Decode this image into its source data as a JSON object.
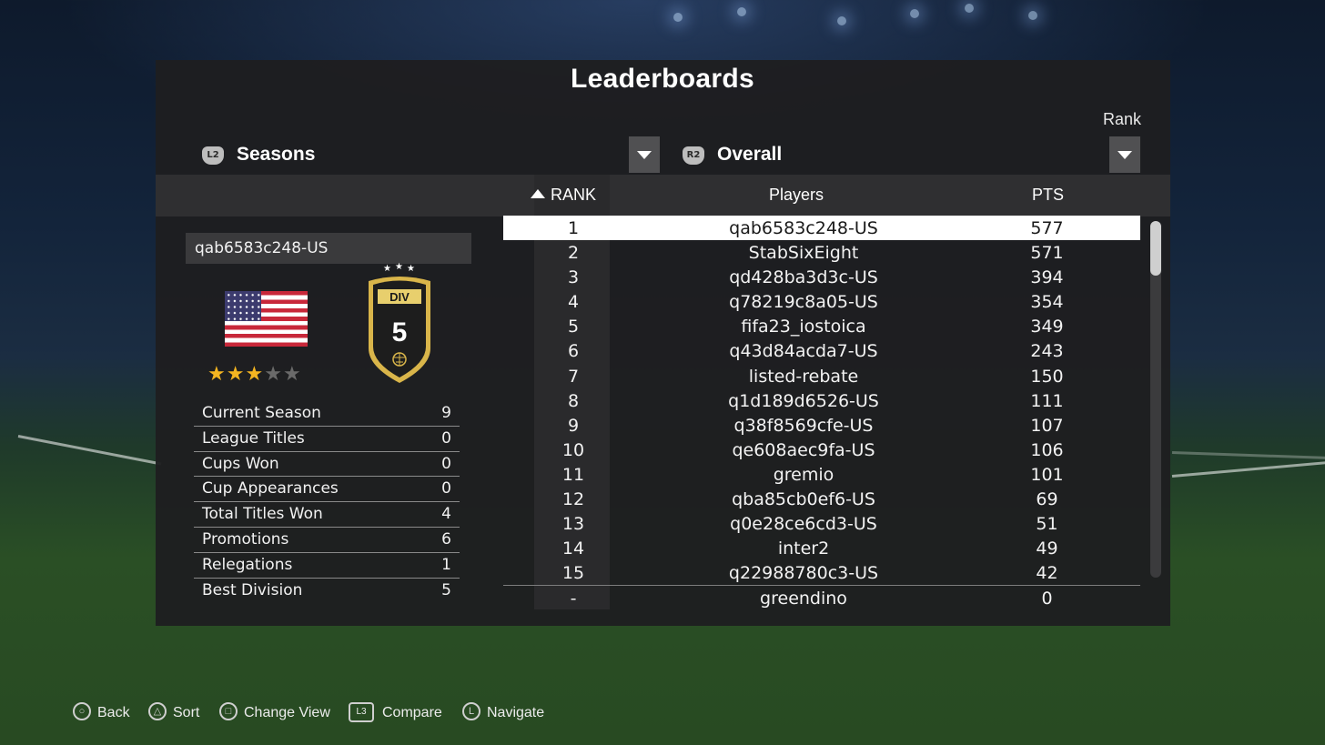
{
  "page": {
    "title": "Leaderboards",
    "rank_caption": "Rank"
  },
  "filters": {
    "left": {
      "button": "L2",
      "label": "Seasons"
    },
    "right": {
      "button": "R2",
      "label": "Overall"
    }
  },
  "table_headers": {
    "rank": "RANK",
    "players": "Players",
    "pts": "PTS"
  },
  "profile": {
    "name": "qab6583c248-US",
    "stars_filled": 3,
    "stars_total": 5,
    "division_label": "DIV",
    "division_number": "5",
    "flag": "united-states"
  },
  "stats": [
    {
      "label": "Current Season",
      "value": "9"
    },
    {
      "label": "League Titles",
      "value": "0"
    },
    {
      "label": "Cups Won",
      "value": "0"
    },
    {
      "label": "Cup Appearances",
      "value": "0"
    },
    {
      "label": "Total Titles Won",
      "value": "4"
    },
    {
      "label": "Promotions",
      "value": "6"
    },
    {
      "label": "Relegations",
      "value": "1"
    },
    {
      "label": "Best Division",
      "value": "5"
    }
  ],
  "leaderboard": [
    {
      "rank": "1",
      "player": "qab6583c248-US",
      "pts": "577"
    },
    {
      "rank": "2",
      "player": "StabSixEight",
      "pts": "571"
    },
    {
      "rank": "3",
      "player": "qd428ba3d3c-US",
      "pts": "394"
    },
    {
      "rank": "4",
      "player": "q78219c8a05-US",
      "pts": "354"
    },
    {
      "rank": "5",
      "player": "fifa23_iostoica",
      "pts": "349"
    },
    {
      "rank": "6",
      "player": "q43d84acda7-US",
      "pts": "243"
    },
    {
      "rank": "7",
      "player": "listed-rebate",
      "pts": "150"
    },
    {
      "rank": "8",
      "player": "q1d189d6526-US",
      "pts": "111"
    },
    {
      "rank": "9",
      "player": "q38f8569cfe-US",
      "pts": "107"
    },
    {
      "rank": "10",
      "player": "qe608aec9fa-US",
      "pts": "106"
    },
    {
      "rank": "11",
      "player": "gremio",
      "pts": "101"
    },
    {
      "rank": "12",
      "player": "qba85cb0ef6-US",
      "pts": "69"
    },
    {
      "rank": "13",
      "player": "q0e28ce6cd3-US",
      "pts": "51"
    },
    {
      "rank": "14",
      "player": "inter2",
      "pts": "49"
    },
    {
      "rank": "15",
      "player": "q22988780c3-US",
      "pts": "42"
    }
  ],
  "footer_row": {
    "rank": "-",
    "player": "greendino",
    "pts": "0"
  },
  "selected_rank": "1",
  "controls": [
    {
      "icon": "circle-button-icon",
      "label": "Back"
    },
    {
      "icon": "triangle-button-icon",
      "label": "Sort"
    },
    {
      "icon": "square-button-icon",
      "label": "Change View"
    },
    {
      "icon": "l3-button-icon",
      "label": "Compare"
    },
    {
      "icon": "left-stick-icon",
      "label": "Navigate"
    }
  ],
  "colors": {
    "star_filled": "#f4b521",
    "badge_gold": "#d9b54a",
    "selected_row": "#ffffff"
  }
}
